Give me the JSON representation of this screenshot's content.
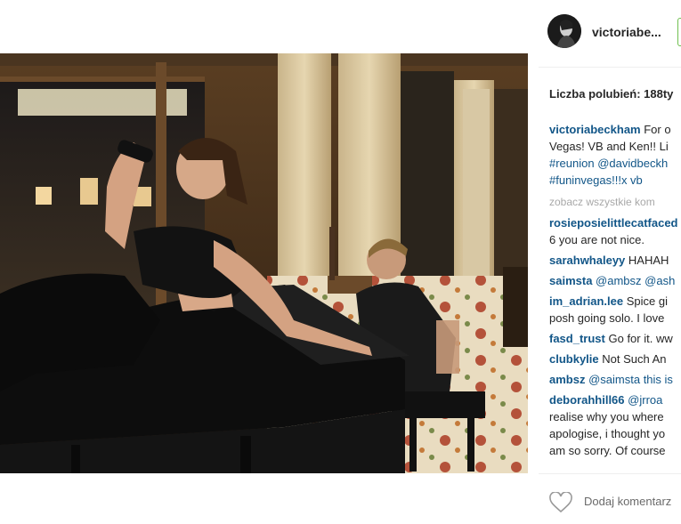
{
  "post": {
    "username": "victoriabe...",
    "likes_text": "Liczba polubień: 188ty",
    "caption": {
      "user": "victoriabeckham",
      "lines": [
        "For o",
        "Vegas! VB and Ken!! Li",
        "#reunion @davidbeckh",
        "#funinvegas!!!x vb"
      ]
    },
    "view_all": "zobacz wszystkie kom",
    "comments": [
      {
        "user": "rosieposielittlecatfaced",
        "text": ""
      },
      {
        "user": "",
        "text": "6 you are not nice."
      },
      {
        "user": "sarahwhaleyy",
        "text": "HAHAH"
      },
      {
        "user": "saimsta",
        "text": "@ambsz @ash"
      },
      {
        "user": "im_adrian.lee",
        "text": "Spice gi"
      },
      {
        "user": "",
        "text": "posh going solo. I love"
      },
      {
        "user": "fasd_trust",
        "text": "Go for it. ww"
      },
      {
        "user": "clubkylie",
        "text": "Not Such An"
      },
      {
        "user": "ambsz",
        "text": "@saimsta this is"
      },
      {
        "user": "deborahhill66",
        "text": "@jrroa"
      },
      {
        "user": "",
        "text": "realise why you where"
      },
      {
        "user": "",
        "text": "apologise, i thought yo"
      },
      {
        "user": "",
        "text": "am so sorry. Of course"
      }
    ],
    "add_comment_placeholder": "Dodaj komentarz"
  },
  "icons": {
    "like": "heart-outline-icon"
  },
  "colors": {
    "username_link": "#125688",
    "follow_border": "#70c050",
    "muted_text": "#a8a8a8"
  }
}
